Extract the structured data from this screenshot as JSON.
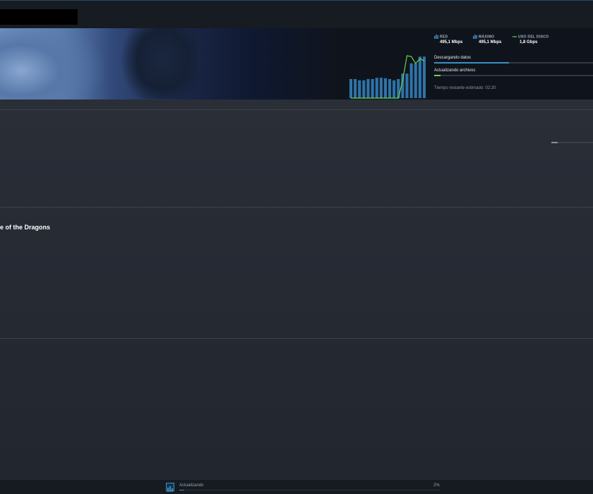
{
  "topbar": {
    "redacted": true
  },
  "banner": {
    "stats": [
      {
        "label": "RED",
        "value": "495,1 Mbps",
        "icon": "network-bars-icon",
        "color": "#3d8ec4"
      },
      {
        "label": "MÁXIMO",
        "value": "495,1 Mbps",
        "icon": "peak-bars-icon",
        "color": "#3d8ec4"
      },
      {
        "label": "USO DEL DISCO",
        "value": "1,8 Gbps",
        "icon": "disk-line-icon",
        "color": "#6ad14b"
      }
    ],
    "progress": [
      {
        "label": "Descargando datos",
        "fraction": 0.47,
        "color": "#3d8ec4"
      },
      {
        "label": "Actualizando archivos",
        "fraction": 0.04,
        "color": "#6ad14b"
      }
    ],
    "eta": "Tiempo restante estimado: 02:20",
    "graph": {
      "bars": [
        0.45,
        0.45,
        0.42,
        0.42,
        0.45,
        0.45,
        0.48,
        0.48,
        0.47,
        0.45,
        0.42,
        0.45,
        0.58,
        0.58,
        0.82,
        0.82,
        0.98,
        0.98
      ],
      "disk_line": [
        0,
        0,
        0,
        0,
        0,
        0,
        0,
        0,
        0,
        0,
        0,
        0,
        0.42,
        1.0,
        0.98,
        0.82,
        0.93,
        0.88
      ]
    }
  },
  "main": {
    "game_title": "e of the Dragons",
    "scroll_fraction": 0.15
  },
  "footer": {
    "status_label": "Actualizando",
    "percent": "2%",
    "fraction": 0.02,
    "icon": "download-queue-icon"
  }
}
